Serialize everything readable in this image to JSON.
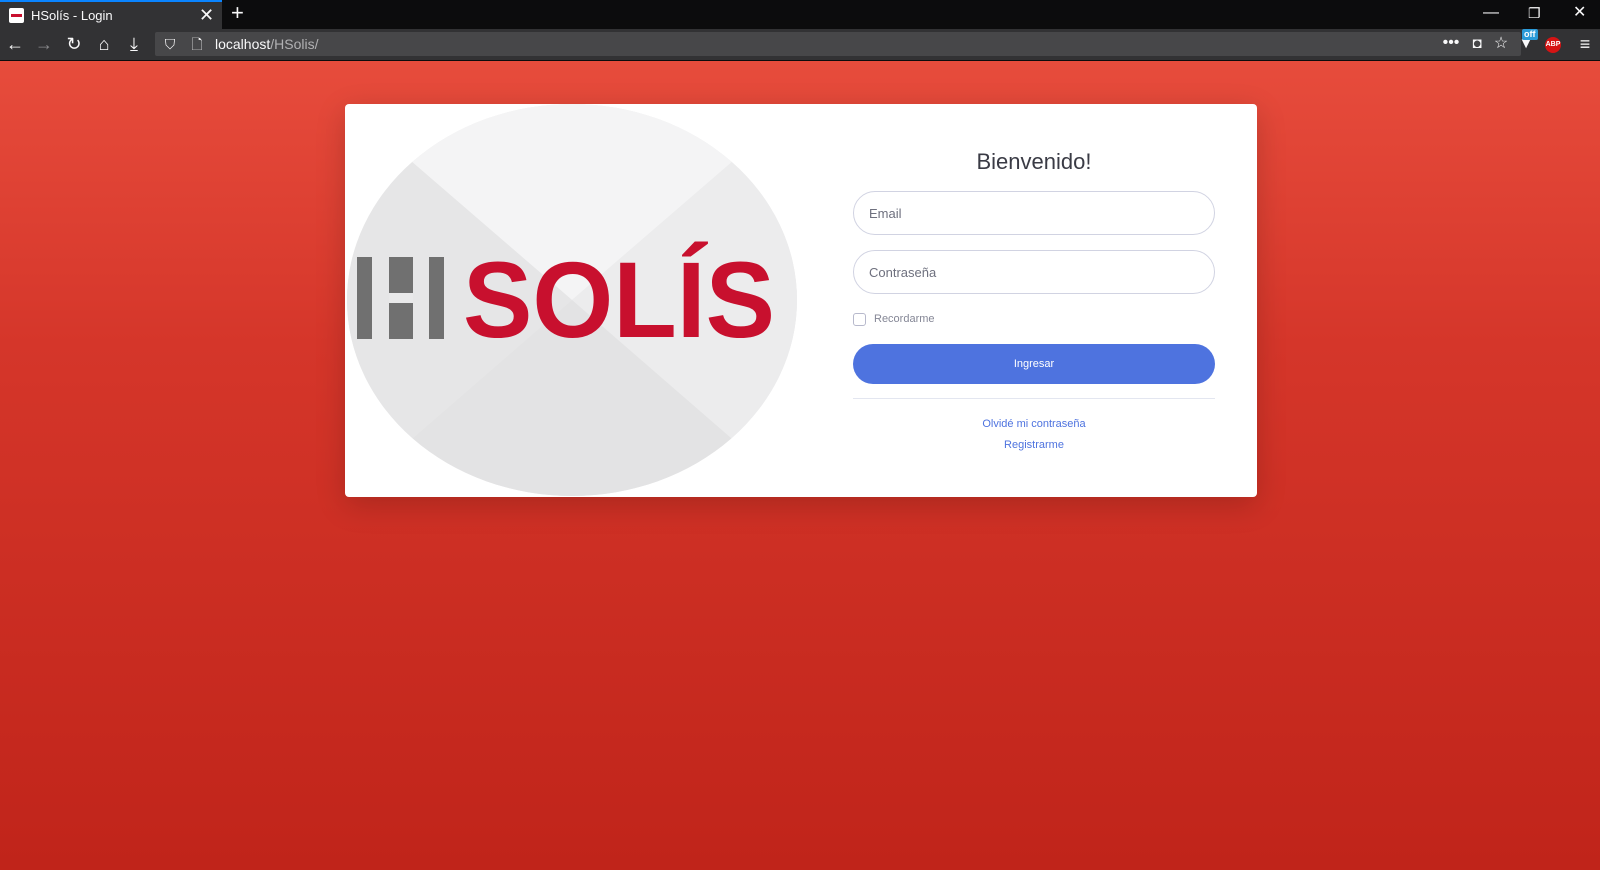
{
  "browser": {
    "tab_title": "HSolís - Login",
    "url_host": "localhost",
    "url_path": "/HSolis/",
    "extension_badge": "off",
    "adblock_label": "ABP"
  },
  "logo": {
    "brand": "SOLÍS",
    "colors": {
      "brand_red": "#c8102e",
      "mark_gray": "#707070"
    }
  },
  "login": {
    "heading": "Bienvenido!",
    "email_placeholder": "Email",
    "password_placeholder": "Contraseña",
    "remember_label": "Recordarme",
    "submit_label": "Ingresar",
    "forgot_link": "Olvidé mi contraseña",
    "register_link": "Registrarme"
  },
  "colors": {
    "background_top": "#e74c3c",
    "background_bottom": "#c0241a",
    "primary": "#4e73df"
  }
}
